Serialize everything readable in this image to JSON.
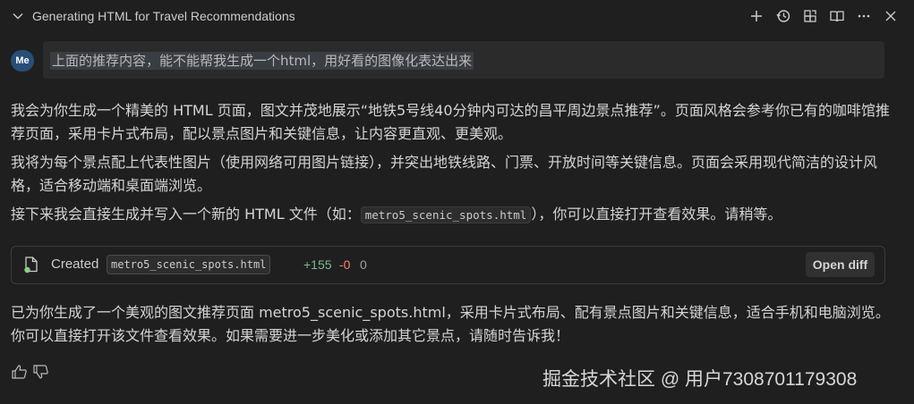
{
  "header": {
    "title": "Generating HTML for Travel Recommendations"
  },
  "user": {
    "avatar": "Me",
    "message": "上面的推荐内容，能不能帮我生成一个html，用好看的图像化表达出来"
  },
  "response": {
    "p1": "我会为你生成一个精美的 HTML 页面，图文并茂地展示“地铁5号线40分钟内可达的昌平周边景点推荐”。页面风格会参考你已有的咖啡馆推荐页面，采用卡片式布局，配以景点图片和关键信息，让内容更直观、更美观。",
    "p2": "我将为每个景点配上代表性图片（使用网络可用图片链接），并突出地铁线路、门票、开放时间等关键信息。页面会采用现代简洁的设计风格，适合移动端和桌面端浏览。",
    "p3_before": "接下来我会直接生成并写入一个新的 HTML 文件（如：",
    "p3_code": "metro5_scenic_spots.html",
    "p3_after": "），你可以直接打开查看效果。请稍等。",
    "p4": "已为你生成了一个美观的图文推荐页面 metro5_scenic_spots.html，采用卡片式布局、配有景点图片和关键信息，适合手机和电脑浏览。你可以直接打开该文件查看效果。如果需要进一步美化或添加其它景点，请随时告诉我！"
  },
  "file_card": {
    "status": "Created",
    "filename": "metro5_scenic_spots.html",
    "additions": "+155",
    "deletions": "-0",
    "extra": "0",
    "open_diff_label": "Open diff"
  },
  "watermark": "掘金技术社区 @ 用户7308701179308",
  "icons": [
    "chevron-down-icon",
    "add-icon",
    "history-icon",
    "open-in-editor-icon",
    "book-icon",
    "more-icon",
    "close-icon",
    "new-file-icon",
    "thumbs-up-icon",
    "thumbs-down-icon"
  ],
  "colors": {
    "background": "#1f1f1f",
    "avatar": "#264f78",
    "additions": "#81b88b",
    "deletions": "#f48771"
  }
}
